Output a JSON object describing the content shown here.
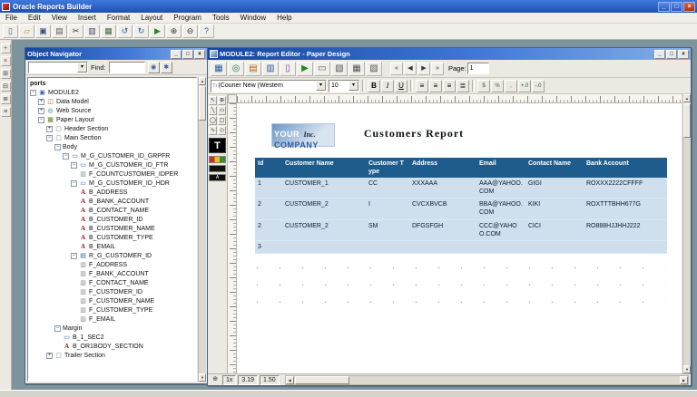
{
  "app": {
    "title": "Oracle Reports Builder",
    "menu": [
      {
        "name": "menu-file",
        "label": "File"
      },
      {
        "name": "menu-edit",
        "label": "Edit"
      },
      {
        "name": "menu-view",
        "label": "View"
      },
      {
        "name": "menu-insert",
        "label": "Insert"
      },
      {
        "name": "menu-format",
        "label": "Format"
      },
      {
        "name": "menu-layout",
        "label": "Layout"
      },
      {
        "name": "menu-program",
        "label": "Program"
      },
      {
        "name": "menu-tools",
        "label": "Tools"
      },
      {
        "name": "menu-window",
        "label": "Window"
      },
      {
        "name": "menu-help",
        "label": "Help"
      }
    ],
    "toolbar": [
      {
        "name": "new-report-button",
        "glyph": "▯",
        "color": "#4a5a8c"
      },
      {
        "name": "open-button",
        "glyph": "▱",
        "color": "#c79222"
      },
      {
        "name": "save-button",
        "glyph": "▣",
        "color": "#3a4a7c"
      },
      {
        "name": "print-button",
        "glyph": "▤",
        "color": "#5a5a5a"
      },
      {
        "name": "cut-button",
        "glyph": "✂",
        "color": "#333333"
      },
      {
        "name": "copy-button",
        "glyph": "▥",
        "color": "#444466"
      },
      {
        "name": "paste-button",
        "glyph": "▦",
        "color": "#446644"
      },
      {
        "name": "undo-button",
        "glyph": "↺",
        "color": "#2a5aa0"
      },
      {
        "name": "redo-button",
        "glyph": "↻",
        "color": "#2a5aa0"
      },
      {
        "name": "run-paper-button",
        "glyph": "▶",
        "color": "#1f8a1f"
      },
      {
        "name": "zoom-in-button",
        "glyph": "⊕",
        "color": "#333333"
      },
      {
        "name": "zoom-out-button",
        "glyph": "⊖",
        "color": "#333333"
      },
      {
        "name": "help-button",
        "glyph": "?",
        "color": "#2a5aa0"
      }
    ],
    "side_toolbar": [
      {
        "name": "create-button",
        "glyph": "+",
        "color": "#1f7a1f"
      },
      {
        "name": "delete-button",
        "glyph": "×",
        "color": "#b02020"
      },
      {
        "name": "expand-button",
        "glyph": "⊞",
        "color": "#444444"
      },
      {
        "name": "collapse-button",
        "glyph": "⊟",
        "color": "#444444"
      },
      {
        "name": "expand-all-button",
        "glyph": "≣",
        "color": "#444444"
      },
      {
        "name": "collapse-all-button",
        "glyph": "≡",
        "color": "#444444"
      }
    ],
    "window_buttons": [
      {
        "name": "minimize-button",
        "glyph": "_"
      },
      {
        "name": "restore-button",
        "glyph": "□"
      },
      {
        "name": "close-button",
        "glyph": "×"
      }
    ]
  },
  "navigator": {
    "title": "Object Navigator",
    "filter_value": "",
    "find_label": "Find:",
    "find_value": "",
    "find_buttons": [
      {
        "name": "find-next-button",
        "glyph": "◉"
      },
      {
        "name": "find-clear-button",
        "glyph": "✱"
      }
    ],
    "tree": [
      {
        "d": 0,
        "e": "none",
        "icon": "",
        "g": "",
        "label": "ports",
        "cls": "bold"
      },
      {
        "d": 0,
        "e": "minus",
        "icon": "report",
        "g": "▣",
        "label": "MODULE2",
        "cls": ""
      },
      {
        "d": 1,
        "e": "plus",
        "icon": "data",
        "g": "◫",
        "label": "Data Model",
        "cls": ""
      },
      {
        "d": 1,
        "e": "plus",
        "icon": "web",
        "g": "◎",
        "label": "Web Source",
        "cls": ""
      },
      {
        "d": 1,
        "e": "minus",
        "icon": "layout",
        "g": "▦",
        "label": "Paper Layout",
        "cls": ""
      },
      {
        "d": 2,
        "e": "plus",
        "icon": "section",
        "g": "▢",
        "label": "Header Section",
        "cls": ""
      },
      {
        "d": 2,
        "e": "minus",
        "icon": "section",
        "g": "▢",
        "label": "Main Section",
        "cls": ""
      },
      {
        "d": 3,
        "e": "minus",
        "icon": "",
        "g": "",
        "label": "Body",
        "cls": ""
      },
      {
        "d": 4,
        "e": "minus",
        "icon": "frame",
        "g": "▭",
        "label": "M_G_CUSTOMER_ID_GRPFR",
        "cls": ""
      },
      {
        "d": 5,
        "e": "minus",
        "icon": "frame",
        "g": "▭",
        "label": "M_G_CUSTOMER_ID_FTR",
        "cls": ""
      },
      {
        "d": 6,
        "e": "none",
        "icon": "field",
        "g": "▥",
        "label": "F_COUNTCUSTOMER_IDPER",
        "cls": ""
      },
      {
        "d": 5,
        "e": "minus",
        "icon": "frame",
        "g": "▭",
        "label": "M_G_CUSTOMER_ID_HDR",
        "cls": ""
      },
      {
        "d": 6,
        "e": "none",
        "icon": "a",
        "g": "A",
        "label": "B_ADDRESS",
        "cls": ""
      },
      {
        "d": 6,
        "e": "none",
        "icon": "a",
        "g": "A",
        "label": "B_BANK_ACCOUNT",
        "cls": ""
      },
      {
        "d": 6,
        "e": "none",
        "icon": "a",
        "g": "A",
        "label": "B_CONTACT_NAME",
        "cls": ""
      },
      {
        "d": 6,
        "e": "none",
        "icon": "a",
        "g": "A",
        "label": "B_CUSTOMER_ID",
        "cls": ""
      },
      {
        "d": 6,
        "e": "none",
        "icon": "a",
        "g": "A",
        "label": "B_CUSTOMER_NAME",
        "cls": ""
      },
      {
        "d": 6,
        "e": "none",
        "icon": "a",
        "g": "A",
        "label": "B_CUSTOMER_TYPE",
        "cls": ""
      },
      {
        "d": 6,
        "e": "none",
        "icon": "a",
        "g": "A",
        "label": "B_EMAIL",
        "cls": ""
      },
      {
        "d": 5,
        "e": "minus",
        "icon": "rframe",
        "g": "▤",
        "label": "R_G_CUSTOMER_ID",
        "cls": ""
      },
      {
        "d": 6,
        "e": "none",
        "icon": "field",
        "g": "▥",
        "label": "F_ADDRESS",
        "cls": ""
      },
      {
        "d": 6,
        "e": "none",
        "icon": "field",
        "g": "▥",
        "label": "F_BANK_ACCOUNT",
        "cls": ""
      },
      {
        "d": 6,
        "e": "none",
        "icon": "field",
        "g": "▥",
        "label": "F_CONTACT_NAME",
        "cls": ""
      },
      {
        "d": 6,
        "e": "none",
        "icon": "field",
        "g": "▥",
        "label": "F_CUSTOMER_ID",
        "cls": ""
      },
      {
        "d": 6,
        "e": "none",
        "icon": "field",
        "g": "▥",
        "label": "F_CUSTOMER_NAME",
        "cls": ""
      },
      {
        "d": 6,
        "e": "none",
        "icon": "field",
        "g": "▥",
        "label": "F_CUSTOMER_TYPE",
        "cls": ""
      },
      {
        "d": 6,
        "e": "none",
        "icon": "field",
        "g": "▥",
        "label": "F_EMAIL",
        "cls": ""
      },
      {
        "d": 3,
        "e": "minus",
        "icon": "",
        "g": "",
        "label": "Margin",
        "cls": ""
      },
      {
        "d": 4,
        "e": "none",
        "icon": "frame",
        "g": "▭",
        "label": "B_1_SEC2",
        "cls": ""
      },
      {
        "d": 4,
        "e": "none",
        "icon": "a",
        "g": "A",
        "label": "B_OR1BODY_SECTION",
        "cls": ""
      },
      {
        "d": 2,
        "e": "plus",
        "icon": "section",
        "g": "▢",
        "label": "Trailer Section",
        "cls": ""
      }
    ]
  },
  "editor": {
    "title": "MODULE2: Report Editor - Paper Design",
    "toolbar": [
      {
        "name": "data-model-button",
        "glyph": "▦",
        "color": "#2a5aa0"
      },
      {
        "name": "web-source-button",
        "glyph": "◎",
        "color": "#1f7a4f"
      },
      {
        "name": "paper-layout-button",
        "glyph": "▤",
        "color": "#b06a1f"
      },
      {
        "name": "paper-design-button",
        "glyph": "▥",
        "color": "#2a5aa0"
      },
      {
        "name": "paper-parameter-button",
        "glyph": "▯",
        "color": "#7a3fa0"
      },
      {
        "name": "run-web-button",
        "glyph": "▶",
        "color": "#1f8a1f"
      },
      {
        "name": "edit-margin-button",
        "glyph": "▭",
        "color": "#555555"
      },
      {
        "name": "header-section-button",
        "glyph": "▧",
        "color": "#555555"
      },
      {
        "name": "main-section-button",
        "glyph": "▦",
        "color": "#555555"
      },
      {
        "name": "trailer-section-button",
        "glyph": "▨",
        "color": "#555555"
      }
    ],
    "page_nav": [
      {
        "name": "first-page-button",
        "glyph": "«"
      },
      {
        "name": "previous-page-button",
        "glyph": "◀"
      },
      {
        "name": "next-page-button",
        "glyph": "▶"
      },
      {
        "name": "last-page-button",
        "glyph": "»"
      }
    ],
    "page_label": "Page:",
    "page_value": "1",
    "format": {
      "tt_icon": "Tr",
      "font": "(Courier New (Western",
      "size": "10",
      "style_buttons": [
        {
          "name": "bold-button",
          "key": "bold",
          "glyph": "B"
        },
        {
          "name": "italic-button",
          "key": "italic",
          "glyph": "I"
        },
        {
          "name": "underline-button",
          "key": "underline",
          "glyph": "U"
        }
      ],
      "align_buttons": [
        {
          "name": "align-left-button",
          "glyph": "≡"
        },
        {
          "name": "align-center-button",
          "glyph": "≡"
        },
        {
          "name": "align-right-button",
          "glyph": "≡"
        },
        {
          "name": "align-justify-button",
          "glyph": "≣"
        }
      ],
      "number_buttons": [
        {
          "name": "currency-button",
          "glyph": "$"
        },
        {
          "name": "percent-button",
          "glyph": "%"
        },
        {
          "name": "comma-button",
          "glyph": ","
        },
        {
          "name": "add-decimal-button",
          "glyph": "+.0"
        },
        {
          "name": "remove-decimal-button",
          "glyph": "-.0"
        }
      ]
    },
    "palette": [
      {
        "name": "select-tool",
        "glyph": "↖"
      },
      {
        "name": "magnifier-tool",
        "glyph": "⊕"
      },
      {
        "name": "line-tool",
        "glyph": "╲"
      },
      {
        "name": "rectangle-tool",
        "glyph": "▭"
      },
      {
        "name": "ellipse-tool",
        "glyph": "◯"
      },
      {
        "name": "rounded-rect-tool",
        "glyph": "▢"
      },
      {
        "name": "polyline-tool",
        "glyph": "∿"
      },
      {
        "name": "polygon-tool",
        "glyph": "◇"
      }
    ],
    "text_tool": {
      "glyph": "T"
    },
    "swatches": [
      {
        "name": "fill-color-button",
        "cls": "sw-fill",
        "glyph": ""
      },
      {
        "name": "line-color-button",
        "cls": "sw-line",
        "glyph": ""
      },
      {
        "name": "text-color-button",
        "cls": "sw-text",
        "glyph": "A"
      }
    ],
    "canvas": {
      "logo": {
        "word1": "YOUR",
        "word2": "COMPANY",
        "suffix": "Inc."
      },
      "report_title": "Customers Report",
      "table": {
        "headers": [
          "Id",
          "Customer Name",
          "Customer Type",
          "Address",
          "Email",
          "Contact Name",
          "Bank Account"
        ],
        "rows": [
          {
            "cells": [
              "1",
              "CUSTOMER_1",
              "CC",
              "XXXAAA",
              "AAA@YAHOO.COM",
              "GIGI",
              "ROXXX2222CFFFF"
            ]
          },
          {
            "cells": [
              "2",
              "CUSTOMER_2",
              "I",
              "CVCXBVCB",
              "BBA@YAHOO.COM",
              "KIKI",
              "ROXTTTBHH677G"
            ]
          },
          {
            "cells": [
              "2",
              "CUSTOMER_2",
              "SM",
              "DFGSFGH",
              "CCC@YAHOO.COM",
              "CICI",
              "RO888HJJHHJ222"
            ]
          },
          {
            "cells": [
              "3",
              "",
              "",
              "",
              "",
              "",
              ""
            ]
          }
        ]
      },
      "colors": {
        "table_header_bg": "#1d5c8c",
        "table_row_bg": "#cfdfee",
        "logo_blue": "#2c5f9e"
      }
    },
    "status": {
      "zoom_icon": "⊕",
      "zoom": "1x",
      "h": "3.19",
      "v": "1.50"
    }
  }
}
